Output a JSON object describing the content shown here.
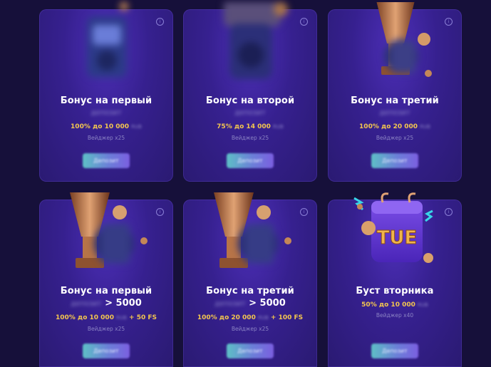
{
  "cards": [
    {
      "title": "Бонус на первый",
      "subtitle_blurred": "депозит",
      "offer_text": "100% до 10 000",
      "offer_currency_blurred": "RUB",
      "wager": "Вейджер x25",
      "button_label": "Депозит",
      "art": "slot-machine-icon"
    },
    {
      "title": "Бонус на второй",
      "subtitle_blurred": "депозит",
      "offer_text": "75% до 14 000",
      "offer_currency_blurred": "RUB",
      "wager": "Вейджер x25",
      "button_label": "Депозит",
      "art": "slot-machine-icon"
    },
    {
      "title": "Бонус на третий",
      "subtitle_blurred": "депозит",
      "offer_text": "100% до 20 000",
      "offer_currency_blurred": "RUB",
      "wager": "Вейджер x25",
      "button_label": "Депозит",
      "art": "trophy-icon"
    },
    {
      "title": "Бонус на первый",
      "subtitle_blurred": "депозит",
      "subtitle_suffix": "> 5000",
      "offer_text": "100% до 10 000",
      "offer_currency_blurred": "RUB",
      "offer_suffix": "+ 50 FS",
      "wager": "Вейджер x25",
      "button_label": "Депозит",
      "art": "trophy-icon"
    },
    {
      "title": "Бонус на третий",
      "subtitle_blurred": "депозит",
      "subtitle_suffix": "> 5000",
      "offer_text": "100% до 20 000",
      "offer_currency_blurred": "RUB",
      "offer_suffix": "+ 100 FS",
      "wager": "Вейджер x25",
      "button_label": "Депозит",
      "art": "trophy-icon"
    },
    {
      "title": "Буст вторника",
      "calendar_text": "TUE",
      "offer_text": "50% до 10 000",
      "offer_currency_blurred": "RUB",
      "wager": "Вейджер x40",
      "button_label": "Депозит",
      "art": "calendar-icon"
    }
  ],
  "colors": {
    "background": "#16103a",
    "card": "#36208f",
    "offer": "#f3c64f",
    "button_start": "#5ec0c6",
    "button_end": "#7b5fe0"
  }
}
